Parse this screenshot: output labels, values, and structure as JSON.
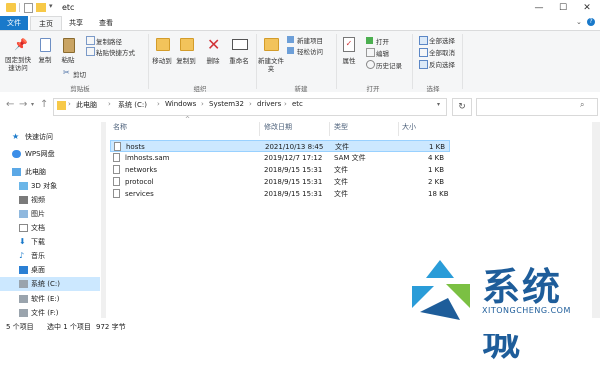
{
  "window": {
    "title": "etc",
    "minimize": "—",
    "maximize": "☐",
    "close": "✕"
  },
  "ribbon_tabs": [
    "文件",
    "主页",
    "共享",
    "查看"
  ],
  "ribbon": {
    "clipboard": {
      "pin": "固定到快速访问",
      "copy": "复制",
      "paste": "粘贴",
      "copy_path": "复制路径",
      "paste_shortcut": "粘贴快捷方式",
      "cut": "剪切",
      "group": "剪贴板"
    },
    "organize": {
      "move_to": "移动到",
      "copy_to": "复制到",
      "delete": "删除",
      "rename": "重命名",
      "group": "组织"
    },
    "new": {
      "new_folder": "新建文件夹",
      "new_item": "新建项目",
      "easy_access": "轻松访问",
      "group": "新建"
    },
    "open": {
      "properties": "属性",
      "open": "打开",
      "edit": "编辑",
      "history": "历史记录",
      "group": "打开"
    },
    "select": {
      "select_all": "全部选择",
      "select_none": "全部取消",
      "invert": "反向选择",
      "group": "选择"
    }
  },
  "address": {
    "back": "←",
    "forward": "→",
    "up": "↑",
    "crumbs": [
      "此电脑",
      "系统 (C:)",
      "Windows",
      "System32",
      "drivers",
      "etc"
    ],
    "refresh": "↻"
  },
  "nav_pane": [
    {
      "label": "快速访问",
      "icon": "star-icon"
    },
    {
      "label": "WPS网盘",
      "icon": "cloud-icon"
    },
    {
      "label": "此电脑",
      "icon": "computer-icon"
    },
    {
      "label": "3D 对象",
      "icon": "cube-icon"
    },
    {
      "label": "视频",
      "icon": "video-icon"
    },
    {
      "label": "图片",
      "icon": "picture-icon"
    },
    {
      "label": "文档",
      "icon": "document-icon"
    },
    {
      "label": "下载",
      "icon": "download-icon"
    },
    {
      "label": "音乐",
      "icon": "music-icon"
    },
    {
      "label": "桌面",
      "icon": "desktop-icon"
    },
    {
      "label": "系统 (C:)",
      "icon": "drive-icon",
      "selected": true
    },
    {
      "label": "软件 (E:)",
      "icon": "drive-icon"
    },
    {
      "label": "文件 (F:)",
      "icon": "drive-icon"
    }
  ],
  "columns": [
    "名称",
    "修改日期",
    "类型",
    "大小"
  ],
  "files": [
    {
      "name": "hosts",
      "date": "2021/10/13 8:45",
      "type": "文件",
      "size": "1 KB",
      "selected": true
    },
    {
      "name": "lmhosts.sam",
      "date": "2019/12/7 17:12",
      "type": "SAM 文件",
      "size": "4 KB"
    },
    {
      "name": "networks",
      "date": "2018/9/15 15:31",
      "type": "文件",
      "size": "1 KB"
    },
    {
      "name": "protocol",
      "date": "2018/9/15 15:31",
      "type": "文件",
      "size": "2 KB"
    },
    {
      "name": "services",
      "date": "2018/9/15 15:31",
      "type": "文件",
      "size": "18 KB"
    }
  ],
  "status": {
    "count": "5 个项目",
    "selected": "选中 1 个项目",
    "size": "972 字节"
  },
  "watermark": {
    "text": "系统城",
    "url": "XITONGCHENG.COM",
    "colors": [
      "#2a9cd8",
      "#7bc043",
      "#1e5d9a"
    ]
  }
}
